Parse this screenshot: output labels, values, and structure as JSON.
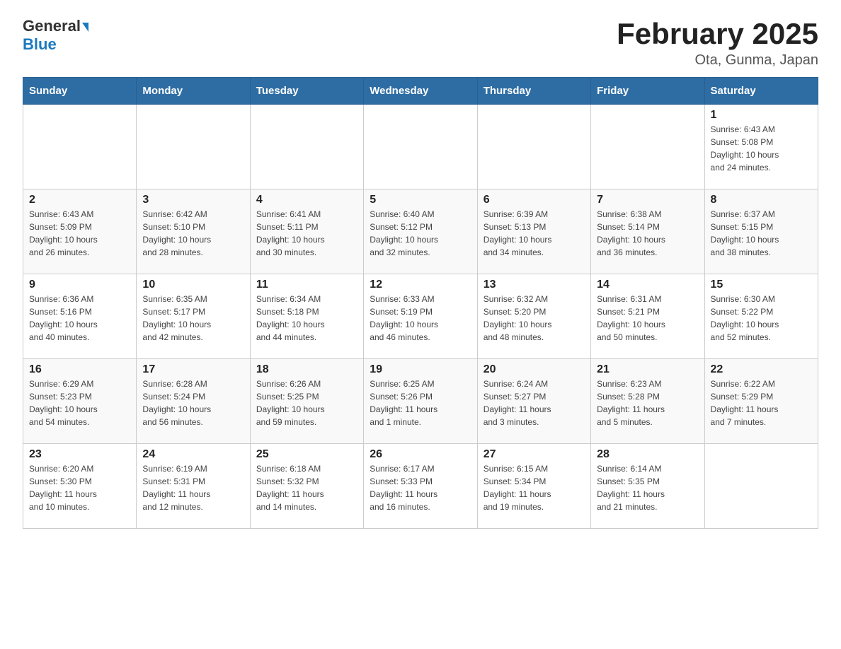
{
  "header": {
    "logo_general": "General",
    "logo_blue": "Blue",
    "title": "February 2025",
    "subtitle": "Ota, Gunma, Japan"
  },
  "weekdays": [
    "Sunday",
    "Monday",
    "Tuesday",
    "Wednesday",
    "Thursday",
    "Friday",
    "Saturday"
  ],
  "weeks": [
    [
      {
        "day": "",
        "info": ""
      },
      {
        "day": "",
        "info": ""
      },
      {
        "day": "",
        "info": ""
      },
      {
        "day": "",
        "info": ""
      },
      {
        "day": "",
        "info": ""
      },
      {
        "day": "",
        "info": ""
      },
      {
        "day": "1",
        "info": "Sunrise: 6:43 AM\nSunset: 5:08 PM\nDaylight: 10 hours\nand 24 minutes."
      }
    ],
    [
      {
        "day": "2",
        "info": "Sunrise: 6:43 AM\nSunset: 5:09 PM\nDaylight: 10 hours\nand 26 minutes."
      },
      {
        "day": "3",
        "info": "Sunrise: 6:42 AM\nSunset: 5:10 PM\nDaylight: 10 hours\nand 28 minutes."
      },
      {
        "day": "4",
        "info": "Sunrise: 6:41 AM\nSunset: 5:11 PM\nDaylight: 10 hours\nand 30 minutes."
      },
      {
        "day": "5",
        "info": "Sunrise: 6:40 AM\nSunset: 5:12 PM\nDaylight: 10 hours\nand 32 minutes."
      },
      {
        "day": "6",
        "info": "Sunrise: 6:39 AM\nSunset: 5:13 PM\nDaylight: 10 hours\nand 34 minutes."
      },
      {
        "day": "7",
        "info": "Sunrise: 6:38 AM\nSunset: 5:14 PM\nDaylight: 10 hours\nand 36 minutes."
      },
      {
        "day": "8",
        "info": "Sunrise: 6:37 AM\nSunset: 5:15 PM\nDaylight: 10 hours\nand 38 minutes."
      }
    ],
    [
      {
        "day": "9",
        "info": "Sunrise: 6:36 AM\nSunset: 5:16 PM\nDaylight: 10 hours\nand 40 minutes."
      },
      {
        "day": "10",
        "info": "Sunrise: 6:35 AM\nSunset: 5:17 PM\nDaylight: 10 hours\nand 42 minutes."
      },
      {
        "day": "11",
        "info": "Sunrise: 6:34 AM\nSunset: 5:18 PM\nDaylight: 10 hours\nand 44 minutes."
      },
      {
        "day": "12",
        "info": "Sunrise: 6:33 AM\nSunset: 5:19 PM\nDaylight: 10 hours\nand 46 minutes."
      },
      {
        "day": "13",
        "info": "Sunrise: 6:32 AM\nSunset: 5:20 PM\nDaylight: 10 hours\nand 48 minutes."
      },
      {
        "day": "14",
        "info": "Sunrise: 6:31 AM\nSunset: 5:21 PM\nDaylight: 10 hours\nand 50 minutes."
      },
      {
        "day": "15",
        "info": "Sunrise: 6:30 AM\nSunset: 5:22 PM\nDaylight: 10 hours\nand 52 minutes."
      }
    ],
    [
      {
        "day": "16",
        "info": "Sunrise: 6:29 AM\nSunset: 5:23 PM\nDaylight: 10 hours\nand 54 minutes."
      },
      {
        "day": "17",
        "info": "Sunrise: 6:28 AM\nSunset: 5:24 PM\nDaylight: 10 hours\nand 56 minutes."
      },
      {
        "day": "18",
        "info": "Sunrise: 6:26 AM\nSunset: 5:25 PM\nDaylight: 10 hours\nand 59 minutes."
      },
      {
        "day": "19",
        "info": "Sunrise: 6:25 AM\nSunset: 5:26 PM\nDaylight: 11 hours\nand 1 minute."
      },
      {
        "day": "20",
        "info": "Sunrise: 6:24 AM\nSunset: 5:27 PM\nDaylight: 11 hours\nand 3 minutes."
      },
      {
        "day": "21",
        "info": "Sunrise: 6:23 AM\nSunset: 5:28 PM\nDaylight: 11 hours\nand 5 minutes."
      },
      {
        "day": "22",
        "info": "Sunrise: 6:22 AM\nSunset: 5:29 PM\nDaylight: 11 hours\nand 7 minutes."
      }
    ],
    [
      {
        "day": "23",
        "info": "Sunrise: 6:20 AM\nSunset: 5:30 PM\nDaylight: 11 hours\nand 10 minutes."
      },
      {
        "day": "24",
        "info": "Sunrise: 6:19 AM\nSunset: 5:31 PM\nDaylight: 11 hours\nand 12 minutes."
      },
      {
        "day": "25",
        "info": "Sunrise: 6:18 AM\nSunset: 5:32 PM\nDaylight: 11 hours\nand 14 minutes."
      },
      {
        "day": "26",
        "info": "Sunrise: 6:17 AM\nSunset: 5:33 PM\nDaylight: 11 hours\nand 16 minutes."
      },
      {
        "day": "27",
        "info": "Sunrise: 6:15 AM\nSunset: 5:34 PM\nDaylight: 11 hours\nand 19 minutes."
      },
      {
        "day": "28",
        "info": "Sunrise: 6:14 AM\nSunset: 5:35 PM\nDaylight: 11 hours\nand 21 minutes."
      },
      {
        "day": "",
        "info": ""
      }
    ]
  ]
}
